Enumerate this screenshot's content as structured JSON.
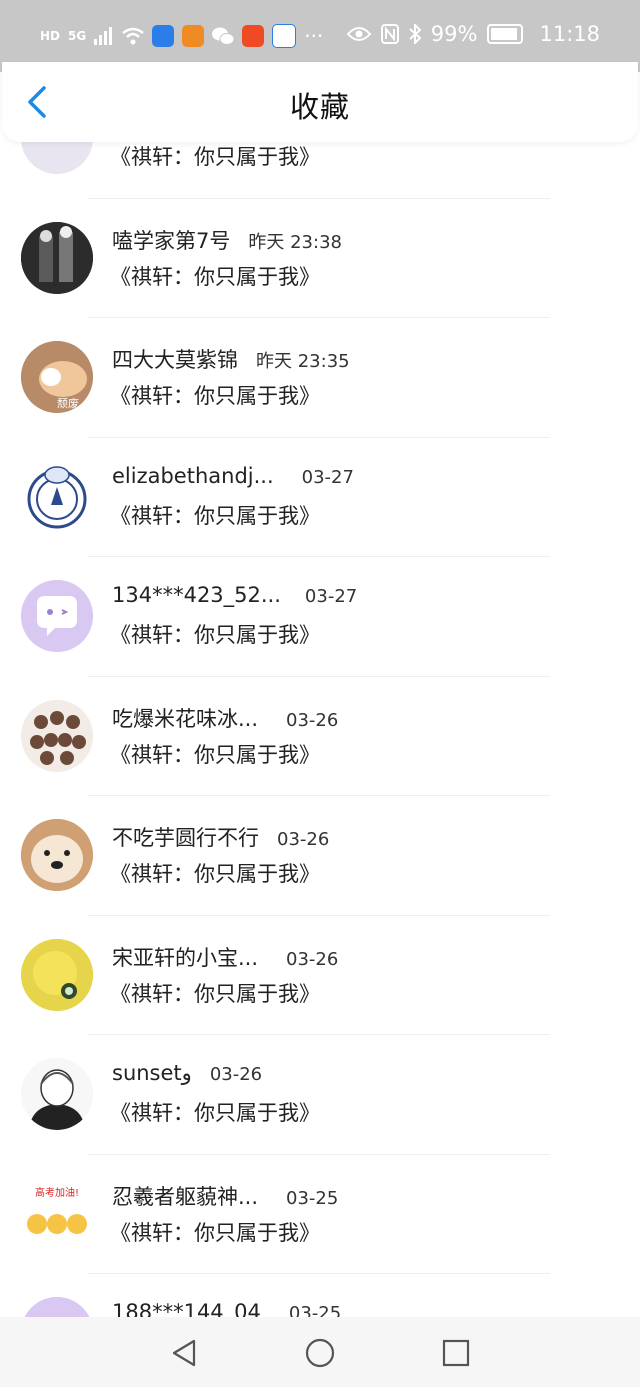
{
  "status_bar": {
    "left_tags": [
      "HD",
      "5G"
    ],
    "battery_text": "99%",
    "time": "11:18",
    "more": "···"
  },
  "header": {
    "title": "收藏",
    "back_icon": "chevron-left-icon"
  },
  "list": {
    "items": [
      {
        "name": "",
        "time": "",
        "subtitle": "《祺轩：你只属于我》",
        "avatar_color": "#e8e4f0"
      },
      {
        "name": "嗑学家第7号",
        "time": "昨天 23:38",
        "subtitle": "《祺轩：你只属于我》",
        "avatar_color": "#3a3a3a"
      },
      {
        "name": "四大大莫紫锦",
        "time": "昨天 23:35",
        "subtitle": "《祺轩：你只属于我》",
        "avatar_color": "#c9a27f",
        "avatar_caption": "颓废"
      },
      {
        "name": "elizabethandj...",
        "time": "03-27",
        "subtitle": "《祺轩：你只属于我》",
        "avatar_color": "#ffffff"
      },
      {
        "name": "134***423_52...",
        "time": "03-27",
        "subtitle": "《祺轩：你只属于我》",
        "avatar_color": "#d9c8f2"
      },
      {
        "name": "吃爆米花味冰...",
        "time": "03-26",
        "subtitle": "《祺轩：你只属于我》",
        "avatar_color": "#f3ece6"
      },
      {
        "name": "不吃芋圆行不行",
        "time": "03-26",
        "subtitle": "《祺轩：你只属于我》",
        "avatar_color": "#d9a679"
      },
      {
        "name": "宋亚轩的小宝...",
        "time": "03-26",
        "subtitle": "《祺轩：你只属于我》",
        "avatar_color": "#e6d54a"
      },
      {
        "name": "sunsetو",
        "time": "03-26",
        "subtitle": "《祺轩：你只属于我》",
        "avatar_color": "#f2f2f2"
      },
      {
        "name": "忍羲者躯藐神...",
        "time": "03-25",
        "subtitle": "《祺轩：你只属于我》",
        "avatar_color": "#ffffff",
        "avatar_caption": "高考加油!"
      },
      {
        "name": "188***144_04",
        "time": "03-25",
        "subtitle": "",
        "avatar_color": "#d9c8f2"
      }
    ]
  },
  "nav_bar": {
    "back_icon": "triangle-back-icon",
    "home_icon": "circle-home-icon",
    "recents_icon": "square-recents-icon"
  },
  "colors": {
    "status_bar_bg": "#c7c7c7",
    "accent_blue": "#1e88e5",
    "text_primary": "#222222"
  }
}
